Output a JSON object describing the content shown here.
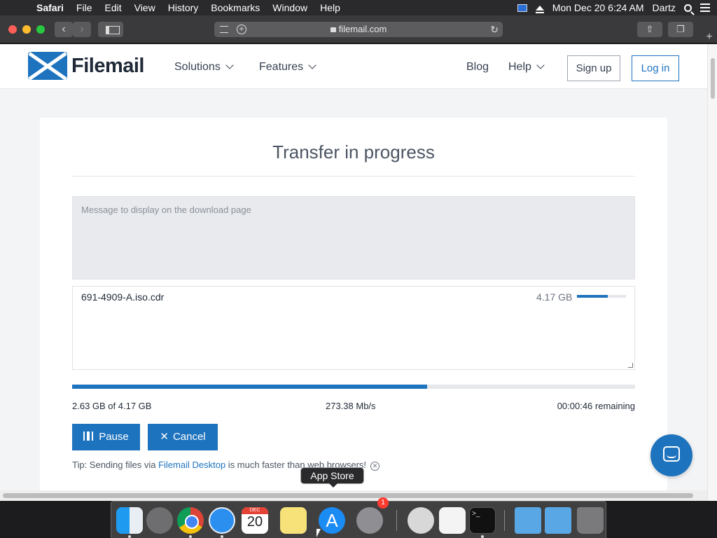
{
  "menubar": {
    "app": "Safari",
    "items": [
      "File",
      "Edit",
      "View",
      "History",
      "Bookmarks",
      "Window",
      "Help"
    ],
    "datetime": "Mon Dec 20  6:24 AM",
    "user": "Dartz"
  },
  "browser": {
    "url": "filemail.com"
  },
  "site": {
    "brand": "Filemail",
    "nav": {
      "solutions": "Solutions",
      "features": "Features",
      "blog": "Blog",
      "help": "Help",
      "signup": "Sign up",
      "login": "Log in"
    }
  },
  "transfer": {
    "title": "Transfer in progress",
    "message_placeholder": "Message to display on the download page",
    "file": {
      "name": "691-4909-A.iso.cdr",
      "size": "4.17 GB",
      "progress": 0.63
    },
    "progress": 0.63,
    "transferred": "2.63 GB of 4.17 GB",
    "speed": "273.38 Mb/s",
    "remaining": "00:00:46 remaining",
    "pause_label": "Pause",
    "cancel_label": "Cancel",
    "tip": {
      "prefix": "Tip: Sending files via ",
      "link": "Filemail Desktop",
      "suffix": " is much faster than web browsers!"
    }
  },
  "dock": {
    "tooltip": "App Store",
    "calendar_month": "DEC",
    "calendar_day": "20",
    "prefs_badge": "1",
    "terminal_prompt": ">_"
  },
  "colors": {
    "accent": "#1e73be"
  }
}
